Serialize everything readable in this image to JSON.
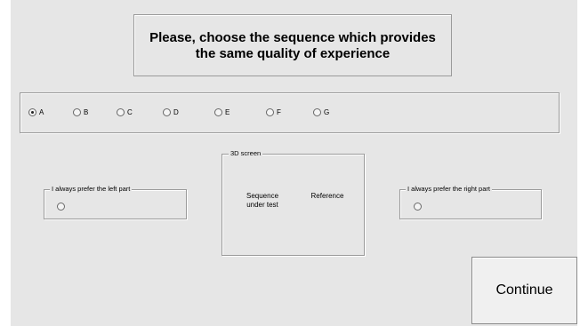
{
  "title": "Please, choose the sequence which provides\nthe same quality of experience",
  "options": [
    {
      "label": "A",
      "checked": true
    },
    {
      "label": "B",
      "checked": false
    },
    {
      "label": "C",
      "checked": false
    },
    {
      "label": "D",
      "checked": false
    },
    {
      "label": "E",
      "checked": false
    },
    {
      "label": "F",
      "checked": false
    },
    {
      "label": "G",
      "checked": false
    }
  ],
  "left_group": {
    "legend": "I always prefer the left part"
  },
  "right_group": {
    "legend": "I always prefer the right part"
  },
  "screen_group": {
    "legend": "3D screen",
    "sequence_label": "Sequence\nunder test",
    "reference_label": "Reference"
  },
  "continue_label": "Continue"
}
